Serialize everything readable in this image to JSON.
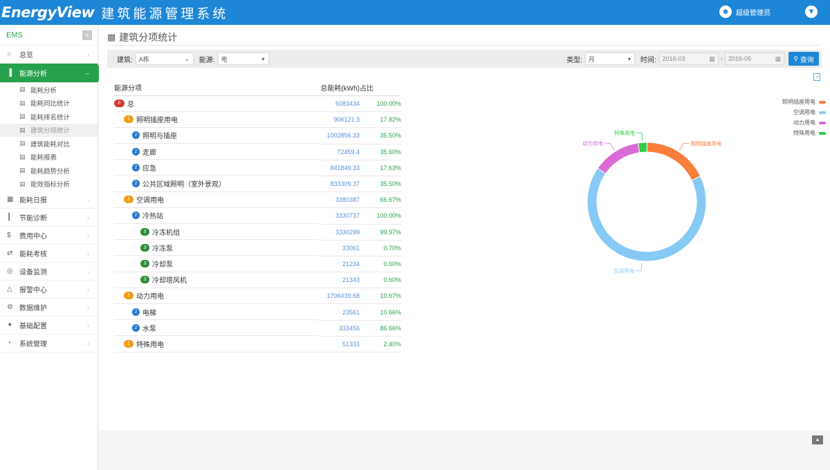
{
  "header": {
    "logo": "EnergyView",
    "system_title": "建筑能源管理系统",
    "user_name": "超级管理员",
    "user_icon": "user-icon",
    "shield_icon": "shield-icon"
  },
  "sidebar": {
    "title": "EMS",
    "collapse_icon": "collapse-icon",
    "items": [
      {
        "label": "总览",
        "icon": "circle-icon",
        "expanded": false
      },
      {
        "label": "能源分析",
        "icon": "building-icon",
        "expanded": true,
        "subitems": [
          {
            "label": "能耗分析"
          },
          {
            "label": "能耗同比统计"
          },
          {
            "label": "能耗排名统计"
          },
          {
            "label": "建筑分项统计",
            "active": true
          },
          {
            "label": "建筑能耗对比"
          },
          {
            "label": "能耗报表"
          },
          {
            "label": "能耗趋势分析"
          },
          {
            "label": "能效指标分析"
          }
        ]
      },
      {
        "label": "能耗日报",
        "icon": "table-icon",
        "expanded": false
      },
      {
        "label": "节能诊断",
        "icon": "chart-icon",
        "expanded": false
      },
      {
        "label": "费用中心",
        "icon": "dollar-icon",
        "expanded": false
      },
      {
        "label": "能耗考核",
        "icon": "arrows-icon",
        "expanded": false
      },
      {
        "label": "设备监测",
        "icon": "device-icon",
        "expanded": false
      },
      {
        "label": "报警中心",
        "icon": "bell-icon",
        "expanded": false
      },
      {
        "label": "数据维护",
        "icon": "gear-icon",
        "expanded": false
      },
      {
        "label": "基础配置",
        "icon": "config-icon",
        "expanded": false
      },
      {
        "label": "系统管理",
        "icon": "system-icon",
        "expanded": false
      }
    ]
  },
  "page": {
    "title": "建筑分项统计",
    "title_icon": "bar-chart-icon"
  },
  "filters": {
    "building_label": "建筑:",
    "building_value": "A栋",
    "energy_label": "能源:",
    "energy_value": "电",
    "type_label": "类型:",
    "type_value": "月",
    "time_label": "时间:",
    "start_date": "2016-03",
    "end_date": "2016-05",
    "date_separator": "-",
    "search_label": "查询"
  },
  "table": {
    "headers": [
      "能源分项",
      "总能耗(kWh)",
      "占比"
    ],
    "rows": [
      {
        "level": 0,
        "badge": "0",
        "name": "总",
        "value": "5083434",
        "pct": "100.00%"
      },
      {
        "level": 1,
        "badge": "1",
        "name": "照明插座用电",
        "value": "906121.3",
        "pct": "17.82%"
      },
      {
        "level": 2,
        "badge": "2",
        "name": "照明与插座",
        "value": "1002856.33",
        "pct": "35.50%"
      },
      {
        "level": 2,
        "badge": "2",
        "name": "走廊",
        "value": "72459.4",
        "pct": "35.60%"
      },
      {
        "level": 2,
        "badge": "2",
        "name": "应急",
        "value": "841849.33",
        "pct": "17.63%"
      },
      {
        "level": 2,
        "badge": "2",
        "name": "公共区域照明（室外景观）",
        "value": "833309.37",
        "pct": "35.50%"
      },
      {
        "level": 1,
        "badge": "1",
        "name": "空调用电",
        "value": "3380387",
        "pct": "66.67%"
      },
      {
        "level": 2,
        "badge": "2",
        "name": "冷热站",
        "value": "3330737",
        "pct": "100.00%"
      },
      {
        "level": 3,
        "badge": "3",
        "name": "冷冻机组",
        "value": "3330299",
        "pct": "99.97%"
      },
      {
        "level": 3,
        "badge": "3",
        "name": "冷冻泵",
        "value": "33061",
        "pct": "0.70%"
      },
      {
        "level": 3,
        "badge": "3",
        "name": "冷却泵",
        "value": "21234",
        "pct": "0.60%"
      },
      {
        "level": 3,
        "badge": "3",
        "name": "冷却塔风机",
        "value": "21343",
        "pct": "0.60%"
      },
      {
        "level": 1,
        "badge": "1",
        "name": "动力用电",
        "value": "1706439.68",
        "pct": "10.67%"
      },
      {
        "level": 2,
        "badge": "2",
        "name": "电梯",
        "value": "23561",
        "pct": "10.66%"
      },
      {
        "level": 2,
        "badge": "2",
        "name": "水泵",
        "value": "333456",
        "pct": "86.66%"
      },
      {
        "level": 1,
        "badge": "1",
        "name": "特殊用电",
        "value": "51333",
        "pct": "2.40%"
      }
    ]
  },
  "chart_data": {
    "type": "pie",
    "style": "donut",
    "slices": [
      {
        "name": "照明插座用电",
        "value": 17.82,
        "color": "#fa7d3c"
      },
      {
        "name": "空调用电",
        "value": 66.67,
        "color": "#86c9f4"
      },
      {
        "name": "动力用电",
        "value": 13.11,
        "color": "#d96ad6"
      },
      {
        "name": "特殊用电",
        "value": 2.4,
        "color": "#33c84a"
      }
    ],
    "legend_position": "top-right"
  },
  "toolbar": {
    "export_icon": "export-icon",
    "footer_button_icon": "up-icon"
  }
}
